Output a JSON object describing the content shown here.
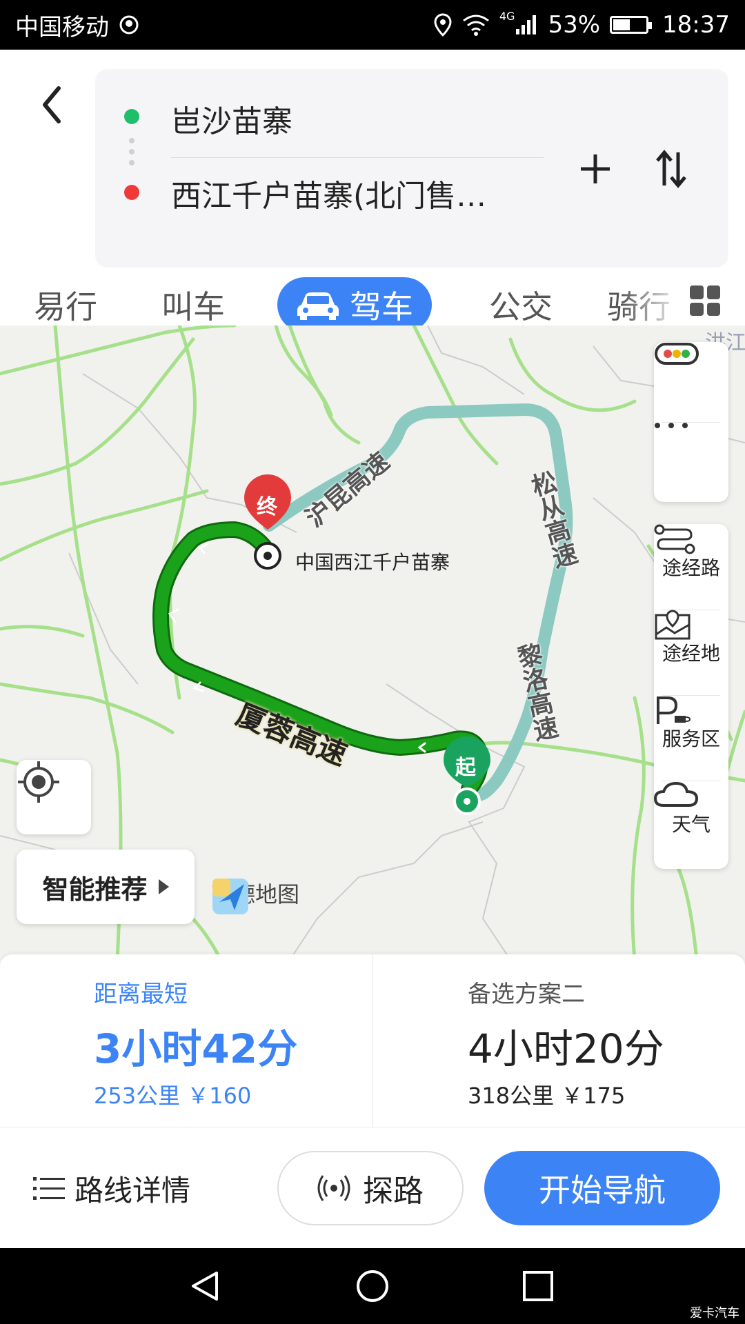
{
  "status_bar": {
    "carrier": "中国移动",
    "network": "4G",
    "battery": "53%",
    "battery_level": 0.53,
    "time": "18:37"
  },
  "header": {
    "start": "岜沙苗寨",
    "destination": "西江千户苗寨(北门售…",
    "modes": [
      "易行",
      "叫车",
      "驾车",
      "公交",
      "骑行"
    ],
    "active_mode": "驾车"
  },
  "map": {
    "destination_marker": "终",
    "start_marker": "起",
    "destination_label": "中国西江千户苗寨",
    "corner_label": "洪江",
    "highways": {
      "hukun": "沪昆高速",
      "songcong": "松从高速",
      "liluo": "黎洛高速",
      "xiarong": "厦蓉高速"
    },
    "controls": {
      "waypoint_route": "途经路",
      "waypoint_place": "途经地",
      "service_area": "服务区",
      "weather": "天气"
    },
    "smart_recommend": "智能推荐",
    "brand": "高德地图",
    "colors": {
      "primary_route": "#1aa31a",
      "alt_route": "#8cc9c0",
      "road": "#a6e08a"
    }
  },
  "routes": [
    {
      "tag": "距离最短",
      "time": "3小时42分",
      "detail": "253公里  ￥160"
    },
    {
      "tag": "备选方案二",
      "time": "4小时20分",
      "detail": "318公里  ￥175"
    }
  ],
  "actions": {
    "details": "路线详情",
    "explore": "探路",
    "start_nav": "开始导航"
  },
  "watermark": "爱卡汽车",
  "accent_color": "#3c84f6"
}
